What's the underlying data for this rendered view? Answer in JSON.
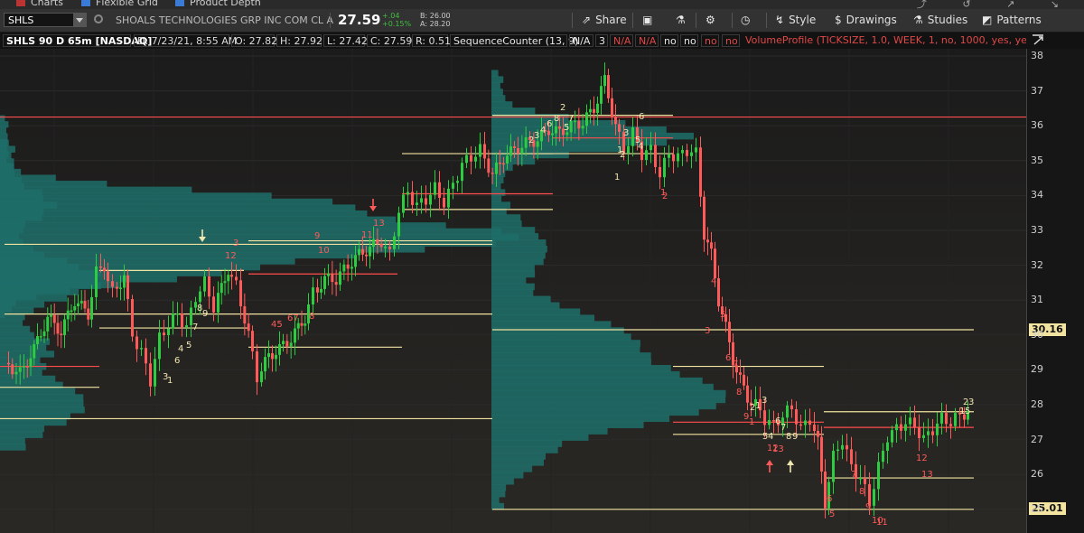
{
  "tabs": [
    "Charts",
    "Flexible Grid",
    "Product Depth"
  ],
  "toolbar": {
    "symbol": "SHLS",
    "company": "SHOALS TECHNOLOGIES GRP INC COM CL A",
    "last": "27.59",
    "change": "+.04",
    "change_pct": "+0.15%",
    "bid": "B: 26.00",
    "ask": "A: 28.20",
    "share": "Share",
    "style": "Style",
    "drawings": "Drawings",
    "studies": "Studies",
    "patterns": "Patterns"
  },
  "info": {
    "title": "SHLS 90 D 65m [NASDAQ]",
    "date": "D: 7/23/21, 8:55 AM",
    "open": "O: 27.82",
    "high": "H: 27.92",
    "low": "L: 27.42",
    "close": "C: 27.59",
    "range": "R: 0.51",
    "study": "SequenceCounter (13, 9)",
    "fields": [
      "N/A",
      "3",
      "N/A",
      "N/A",
      "no",
      "no",
      "no",
      "no"
    ],
    "profile": "VolumeProfile (TICKSIZE, 1.0, WEEK, 1, no, 1000, yes, yes,..."
  },
  "axis": {
    "ticks": [
      "38",
      "37",
      "36",
      "35",
      "34",
      "33",
      "32",
      "31",
      "30",
      "29",
      "28",
      "27",
      "26",
      "25"
    ],
    "tag_high": "30.16",
    "tag_low": "25.01"
  },
  "colors": {
    "up": "#2ecc40",
    "down": "#ff5a5a",
    "profile": "#1e6f6a",
    "poc": "#ff4d4d",
    "level": "#f2e3a0",
    "seq_up": "#f0e6b0",
    "seq_down": "#ff5a5a"
  },
  "chart_data": {
    "type": "candlestick",
    "ylim": [
      24.7,
      38.2
    ],
    "sequence_labels": [
      [
        "8",
        "9",
        "7",
        "4",
        "5",
        "6",
        "3",
        "1",
        "2",
        "8",
        "7",
        "6",
        "5",
        "4",
        "3",
        "2",
        "1",
        "6",
        "5",
        "4",
        "3",
        "2",
        "1"
      ],
      [
        "3",
        "12",
        "45",
        "67",
        "8",
        "9",
        "10",
        "11",
        "13",
        "2",
        "1",
        "3",
        "4",
        "5",
        "6",
        "7",
        "8",
        "9",
        "1",
        "12",
        "13",
        "5",
        "6",
        "7",
        "8",
        "9",
        "10",
        "11",
        "12",
        "13"
      ]
    ]
  }
}
